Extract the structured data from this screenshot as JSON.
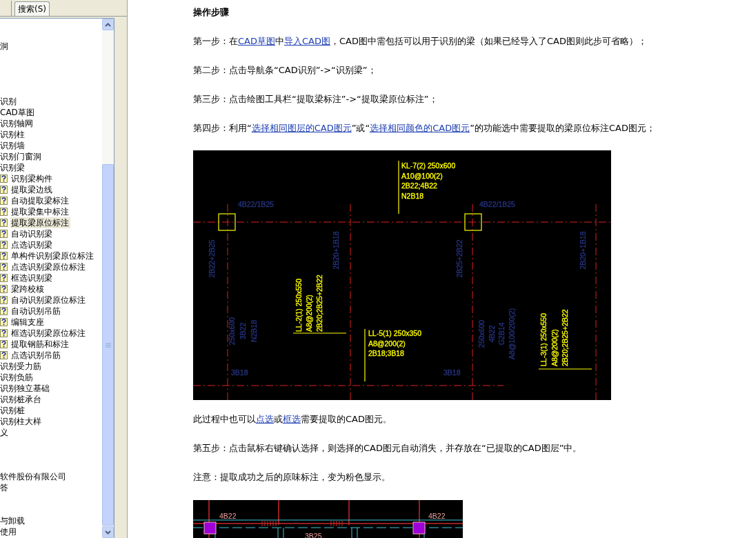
{
  "sidebar": {
    "tab": {
      "label": "搜索(S)"
    },
    "tree": [
      {
        "label": "洞",
        "selected": false
      },
      {
        "label": "识别",
        "selected": false
      },
      {
        "label": "CAD草图",
        "selected": false
      },
      {
        "label": "识别轴网",
        "selected": false
      },
      {
        "label": "识别柱",
        "selected": false
      },
      {
        "label": "识别墙",
        "selected": false
      },
      {
        "label": "识别门窗洞",
        "selected": false
      },
      {
        "label": "识别梁",
        "selected": false,
        "children": [
          {
            "label": "识别梁构件",
            "selected": false
          },
          {
            "label": "提取梁边线",
            "selected": false
          },
          {
            "label": "自动提取梁标注",
            "selected": false
          },
          {
            "label": "提取梁集中标注",
            "selected": false
          },
          {
            "label": "提取梁原位标注",
            "selected": true
          },
          {
            "label": "自动识别梁",
            "selected": false
          },
          {
            "label": "点选识别梁",
            "selected": false
          },
          {
            "label": "单构件识别梁原位标注",
            "selected": false
          },
          {
            "label": "点选识别梁原位标注",
            "selected": false
          },
          {
            "label": "框选识别梁",
            "selected": false
          },
          {
            "label": "梁跨校核",
            "selected": false
          },
          {
            "label": "自动识别梁原位标注",
            "selected": false
          },
          {
            "label": "自动识别吊筋",
            "selected": false
          },
          {
            "label": "编辑支座",
            "selected": false
          },
          {
            "label": "框选识别梁原位标注",
            "selected": false
          },
          {
            "label": "提取钢筋和标注",
            "selected": false
          },
          {
            "label": "点选识别吊筋",
            "selected": false
          }
        ]
      },
      {
        "label": "识别受力筋",
        "selected": false
      },
      {
        "label": "识别负筋",
        "selected": false
      },
      {
        "label": "识别独立基础",
        "selected": false
      },
      {
        "label": "识别桩承台",
        "selected": false
      },
      {
        "label": "识别桩",
        "selected": false
      },
      {
        "label": "识别柱大样",
        "selected": false
      },
      {
        "label": "义",
        "selected": false
      },
      {
        "label": "软件股份有限公司",
        "selected": false
      },
      {
        "label": "答",
        "selected": false
      },
      {
        "label": "与卸载",
        "selected": false
      },
      {
        "label": "使用",
        "selected": false
      }
    ]
  },
  "content": {
    "heading": "操作步骤",
    "blocks": [
      {
        "kind": "paragraph",
        "segments": [
          {
            "text": "第一步：在",
            "kind": "text"
          },
          {
            "text": "CAD草图",
            "kind": "link"
          },
          {
            "text": "中",
            "kind": "text"
          },
          {
            "text": "导入CAD图",
            "kind": "link"
          },
          {
            "text": "，CAD图中需包括可以用于识别的梁（如果已经导入了CAD图则此步可省略）；",
            "kind": "text"
          }
        ]
      },
      {
        "kind": "paragraph",
        "segments": [
          {
            "text": "第二步：点击导航条“CAD识别”->“识别梁”；",
            "kind": "text"
          }
        ]
      },
      {
        "kind": "paragraph",
        "segments": [
          {
            "text": "第三步：点击绘图工具栏“提取梁标注”->“提取梁原位标注”；",
            "kind": "text"
          }
        ]
      },
      {
        "kind": "paragraph",
        "segments": [
          {
            "text": "第四步：利用“",
            "kind": "text"
          },
          {
            "text": "选择相同图层的CAD图元",
            "kind": "link"
          },
          {
            "text": "”或“",
            "kind": "text"
          },
          {
            "text": "选择相同颜色的CAD图元",
            "kind": "link"
          },
          {
            "text": "”的功能选中需要提取的梁原位标注CAD图元；",
            "kind": "text"
          }
        ]
      },
      {
        "kind": "cad_plan",
        "labels": [
          {
            "lines": [
              "KL-7(2) 250x600",
              "A10@100(2)",
              "2B22;4B22",
              "N2B18"
            ],
            "color": "#ffff00"
          },
          {
            "lines": [
              "4B22/1B25"
            ],
            "color": "#26337f"
          },
          {
            "lines": [
              "4B22/1B25"
            ],
            "color": "#26337f"
          },
          {
            "lines": [
              "2B22+2B25"
            ],
            "color": "#26337f"
          },
          {
            "lines": [
              "2B20+1B18"
            ],
            "color": "#26337f"
          },
          {
            "lines": [
              "250x600",
              "3B22",
              "N2B18"
            ],
            "color": "#26337f"
          },
          {
            "lines": [
              "3B18"
            ],
            "color": "#26337f"
          },
          {
            "lines": [
              "LL-2(1) 250x550",
              "A8@200(2)",
              "2B20;2B25+2B22"
            ],
            "color": "#ffff00"
          },
          {
            "lines": [
              "LL-5(1) 250x350",
              "A8@200(2)",
              "2B18;3B18"
            ],
            "color": "#ffff00"
          },
          {
            "lines": [
              "2B25+2B22"
            ],
            "color": "#26337f"
          },
          {
            "lines": [
              "2B20+1B18"
            ],
            "color": "#26337f"
          },
          {
            "lines": [
              "250x600",
              "4B22",
              "G2B14",
              "A8@100/200(2)"
            ],
            "color": "#26337f"
          },
          {
            "lines": [
              "3B18"
            ],
            "color": "#26337f"
          },
          {
            "lines": [
              "LL-3(1) 250x550",
              "A8@200(2)",
              "2B20;2B25+2B22"
            ],
            "color": "#ffff00"
          }
        ]
      },
      {
        "kind": "paragraph",
        "segments": [
          {
            "text": "此过程中也可以",
            "kind": "text"
          },
          {
            "text": "点选",
            "kind": "link"
          },
          {
            "text": "或",
            "kind": "text"
          },
          {
            "text": "框选",
            "kind": "link"
          },
          {
            "text": "需要提取的CAD图元。",
            "kind": "text"
          }
        ]
      },
      {
        "kind": "paragraph",
        "segments": [
          {
            "text": "第五步：点击鼠标右键确认选择，则选择的CAD图元自动消失，并存放在“已提取的CAD图层”中。",
            "kind": "text"
          }
        ]
      },
      {
        "kind": "paragraph",
        "segments": [
          {
            "text": "注意：提取成功之后的原味标注，变为粉色显示。",
            "kind": "text"
          }
        ]
      },
      {
        "kind": "cad_detail",
        "labels": [
          {
            "lines": [
              "4B22"
            ]
          },
          {
            "lines": [
              "4B22"
            ]
          },
          {
            "lines": [
              "3B25"
            ]
          }
        ]
      }
    ]
  }
}
